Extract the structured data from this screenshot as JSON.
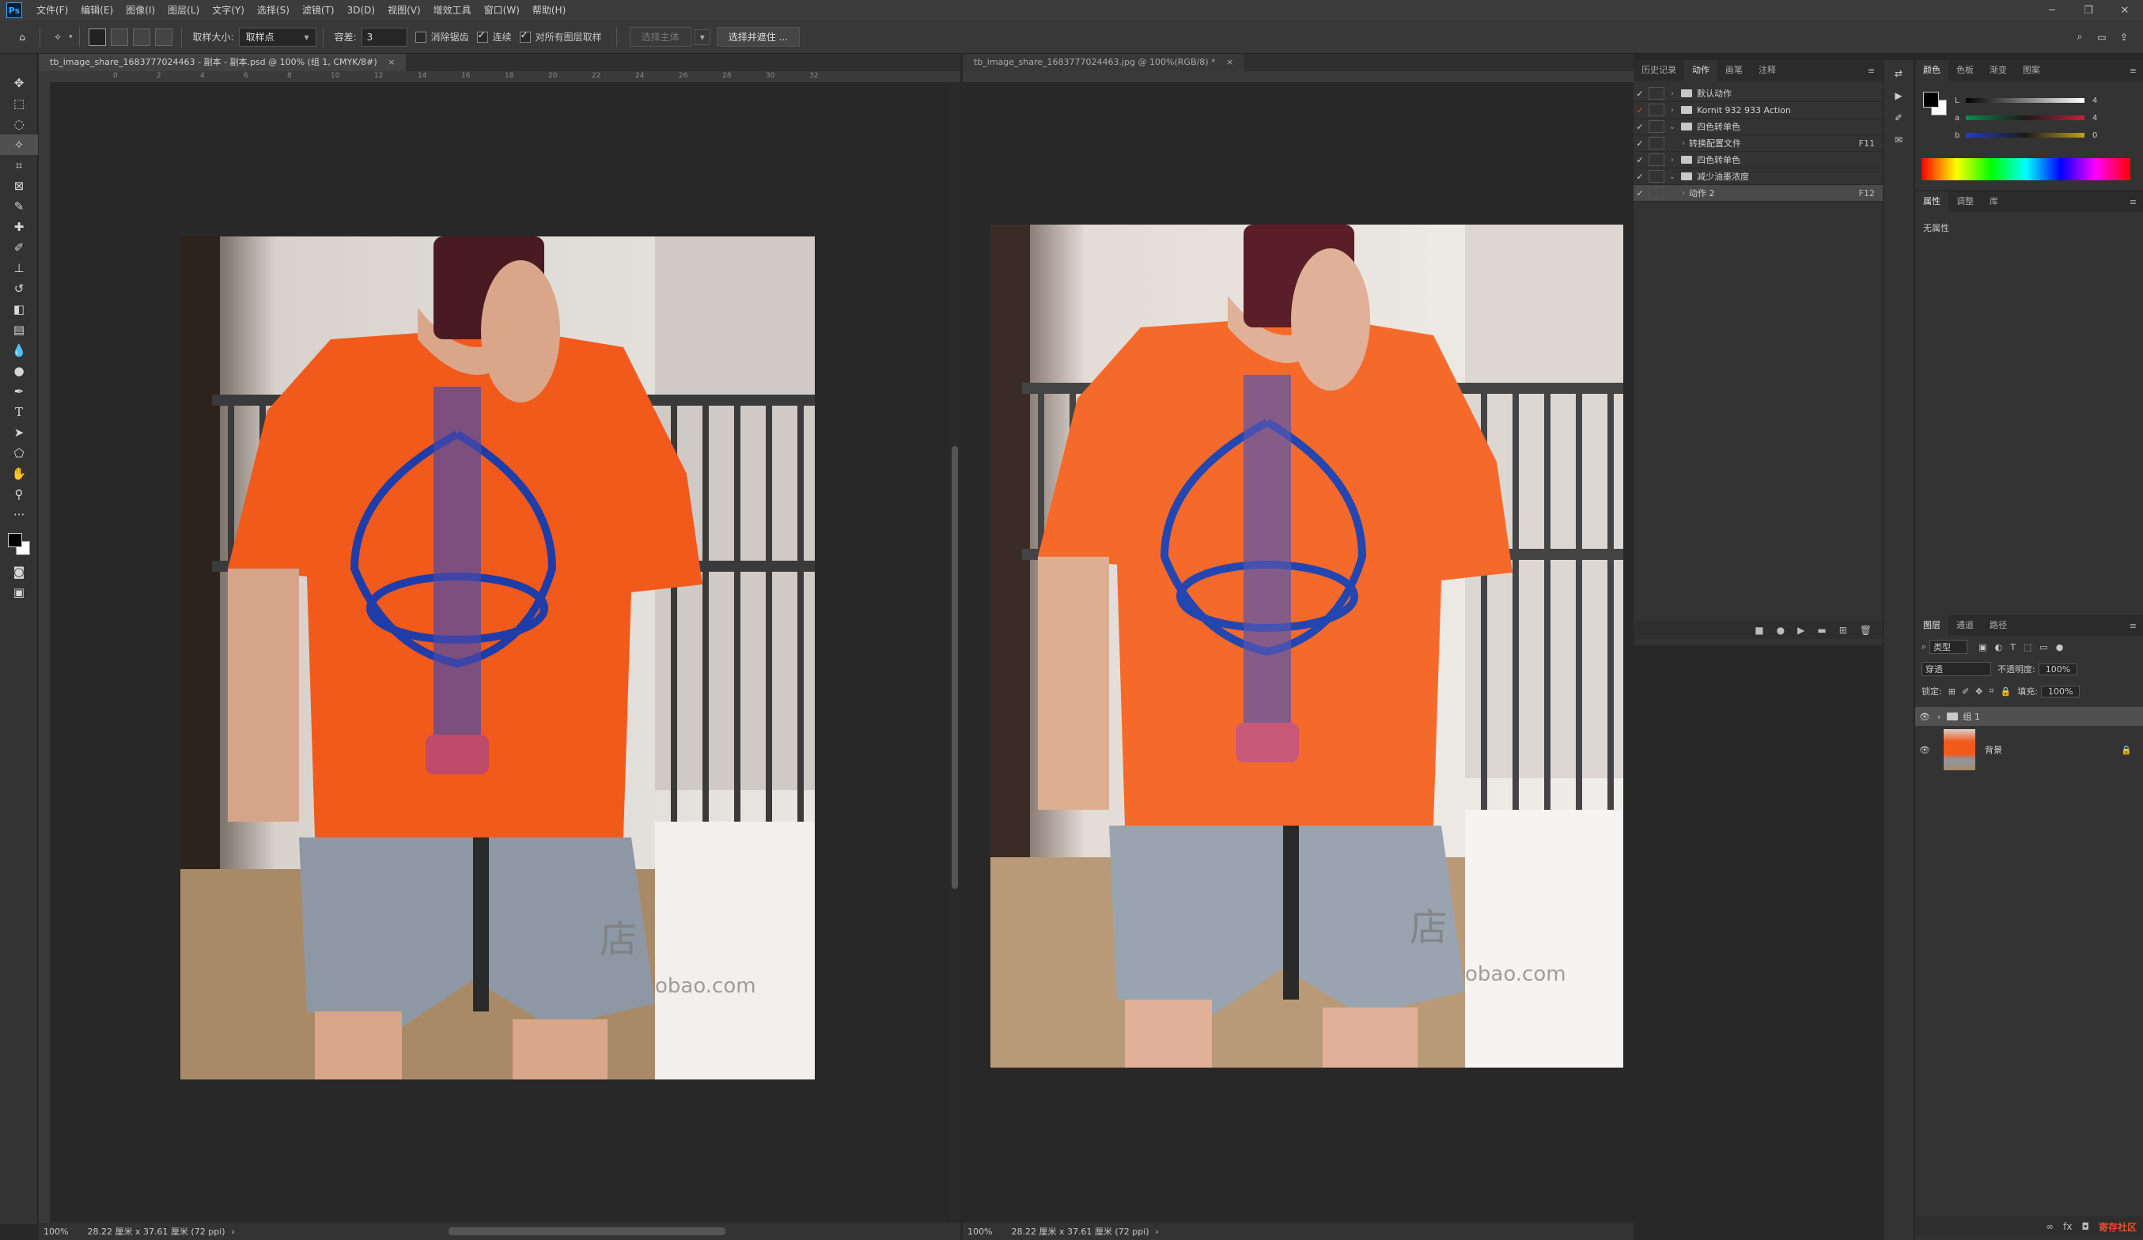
{
  "app": {
    "logo": "Ps",
    "menu": [
      "文件(F)",
      "编辑(E)",
      "图像(I)",
      "图层(L)",
      "文字(Y)",
      "选择(S)",
      "滤镜(T)",
      "3D(D)",
      "视图(V)",
      "增效工具",
      "窗口(W)",
      "帮助(H)"
    ],
    "window_controls": [
      "─",
      "❐",
      "✕"
    ]
  },
  "options": {
    "sample_size_label": "取样大小:",
    "sample_size_value": "取样点",
    "tolerance_label": "容差:",
    "tolerance_value": "3",
    "antialias_label": "消除锯齿",
    "antialias_checked": false,
    "contiguous_label": "连续",
    "contiguous_checked": true,
    "all_layers_label": "对所有图层取样",
    "all_layers_checked": true,
    "select_subject_label": "选择主体",
    "select_mask_label": "选择并遮住 ..."
  },
  "doc_left": {
    "tab_title": "tb_image_share_1683777024463 - 副本 - 副本.psd @ 100% (组 1, CMYK/8#)",
    "zoom": "100%",
    "size_info": "28.22 厘米 x 37.61 厘米 (72 ppi)",
    "ruler_marks": [
      "0",
      "2",
      "4",
      "6",
      "8",
      "10",
      "12",
      "14",
      "16",
      "18",
      "20",
      "22",
      "24",
      "26",
      "28",
      "30",
      "32"
    ]
  },
  "doc_right": {
    "tab_title": "tb_image_share_1683777024463.jpg @ 100%(RGB/8) *",
    "zoom": "100%",
    "size_info": "28.22 厘米 x 37.61 厘米 (72 ppi)"
  },
  "watermark": {
    "char": "店",
    "url": "obao.com"
  },
  "actions_panel": {
    "tabs": [
      "历史记录",
      "动作",
      "画笔",
      "注释"
    ],
    "active_tab": "动作",
    "items": [
      {
        "label": "默认动作",
        "type": "set",
        "expanded": false,
        "key": ""
      },
      {
        "label": "Kornit 932 933 Action",
        "type": "set",
        "expanded": false,
        "key": ""
      },
      {
        "label": "四色转单色",
        "type": "set",
        "expanded": true,
        "key": ""
      },
      {
        "label": "转换配置文件",
        "type": "action",
        "expanded": false,
        "key": "F11"
      },
      {
        "label": "四色转单色",
        "type": "set",
        "expanded": false,
        "key": ""
      },
      {
        "label": "减少油墨浓度",
        "type": "set",
        "expanded": true,
        "key": ""
      },
      {
        "label": "动作 2",
        "type": "action",
        "expanded": false,
        "key": "F12"
      }
    ]
  },
  "color_panel": {
    "tabs": [
      "颜色",
      "色板",
      "渐变",
      "图案"
    ],
    "channels": [
      {
        "name": "L",
        "value": "4"
      },
      {
        "name": "a",
        "value": "4"
      },
      {
        "name": "b",
        "value": "0"
      }
    ]
  },
  "properties_panel": {
    "tabs": [
      "属性",
      "调整",
      "库"
    ],
    "message": "无属性"
  },
  "layers_panel": {
    "tabs": [
      "图层",
      "通道",
      "路径"
    ],
    "filter_label": "类型",
    "blend_mode": "穿透",
    "opacity_label": "不透明度:",
    "opacity_value": "100%",
    "lock_label": "锁定:",
    "fill_label": "填充:",
    "fill_value": "100%",
    "layers": [
      {
        "name": "组 1",
        "type": "group"
      },
      {
        "name": "背景",
        "type": "image"
      }
    ]
  },
  "site_logo": "寄存社区"
}
